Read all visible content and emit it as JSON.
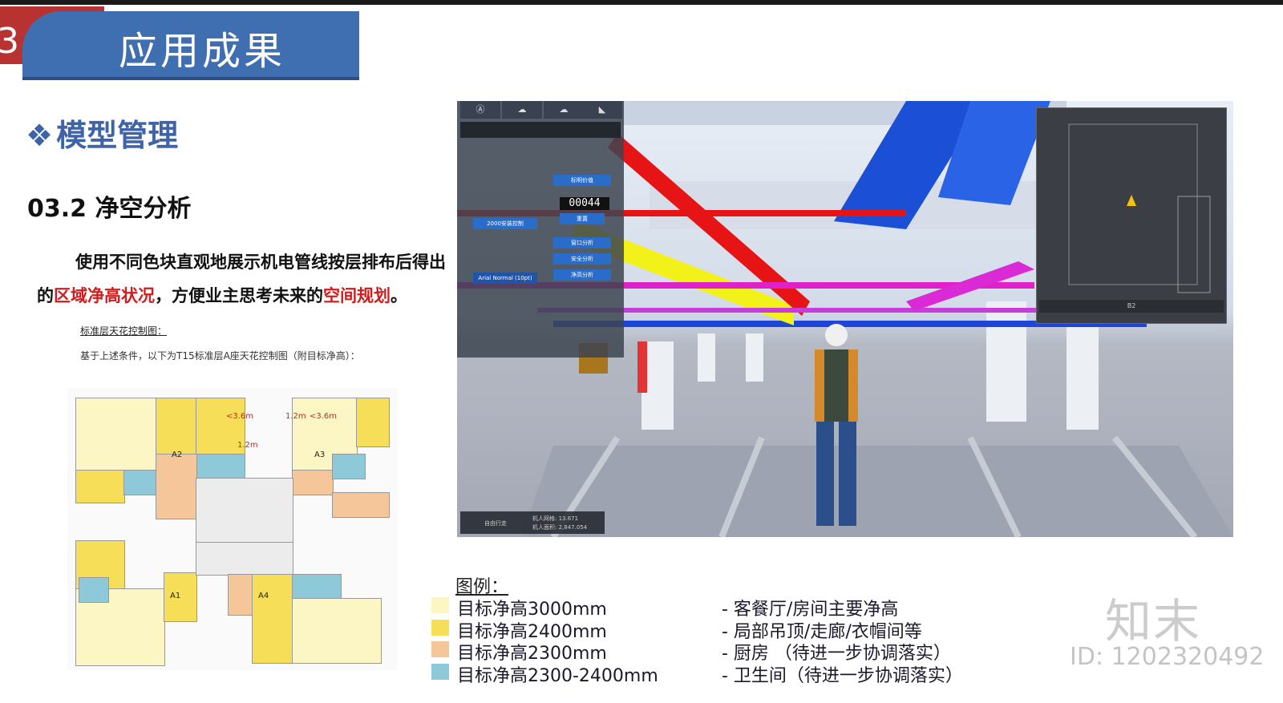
{
  "header": {
    "section_number": "3",
    "title": "应用成果"
  },
  "section_heading": "模型管理",
  "section_symbol": "❖",
  "subtitle": "03.2 净空分析",
  "description": {
    "part1": "使用不同色块直观地展示机电管线按层排布后得出的",
    "highlight1": "区域净高状况",
    "part2": "，方便业主思考未来的",
    "highlight2": "空间规划",
    "part3": "。"
  },
  "floor_plan": {
    "title": "标准层天花控制图：",
    "note": "基于上述条件，以下为T15标准层A座天花控制图（附目标净高）：",
    "unit_labels": [
      "A2",
      "A3",
      "A1",
      "A4"
    ],
    "dimension_labels": [
      "<3.6m",
      "1.2m",
      "<3.6m",
      "1.2m"
    ]
  },
  "viewer": {
    "tabs": [
      "Ⓐ",
      "☁",
      "☁",
      "◣"
    ],
    "counter": "00044",
    "buttons": [
      "标明价值",
      "重置",
      "窗口分析",
      "安全分析",
      "净高分析"
    ],
    "panel_button": "2000安装控制",
    "font_select": "Arial Normal (10pt)",
    "minimap_selector": "B2",
    "status_line1": "机人网格: 13.671",
    "status_line2": "机人面积: 2,847.054",
    "status_left": "自由行走"
  },
  "legend": {
    "title": "图例：",
    "items": [
      {
        "label": "目标净高3000mm",
        "note": "- 客餐厅/房间主要净高",
        "color": "#fbf6c4"
      },
      {
        "label": "目标净高2400mm",
        "note": "- 局部吊顶/走廊/衣帽间等",
        "color": "#f6de58"
      },
      {
        "label": "目标净高2300mm",
        "note": "- 厨房 （待进一步协调落实）",
        "color": "#f5c69a"
      },
      {
        "label": "目标净高2300-2400mm",
        "note": "- 卫生间（待进一步协调落实）",
        "color": "#8ec9d9"
      }
    ]
  },
  "watermark": {
    "logo": "知末",
    "id": "ID: 1202320492"
  },
  "colors": {
    "title_bar": "#3f6fb0",
    "badge": "#b83232",
    "heading": "#3f63a8",
    "highlight": "#d21c1c"
  }
}
